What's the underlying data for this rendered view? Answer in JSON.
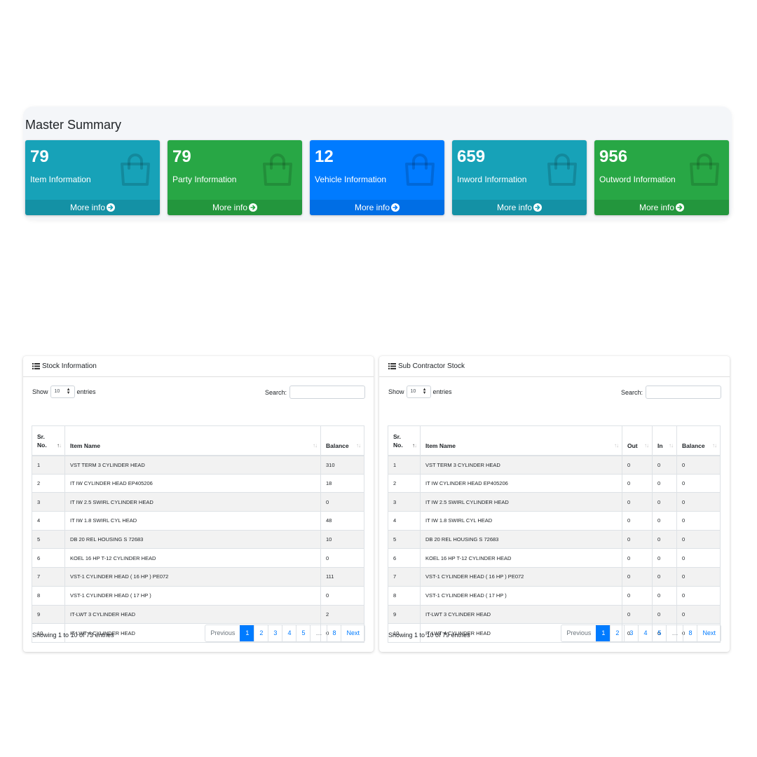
{
  "summary": {
    "title": "Master Summary",
    "more_info": "More info",
    "boxes": [
      {
        "number": "79",
        "label": "Item Information",
        "color": "#17a2b8"
      },
      {
        "number": "79",
        "label": "Party Information",
        "color": "#28a745"
      },
      {
        "number": "12",
        "label": "Vehicle Information",
        "color": "#007bff"
      },
      {
        "number": "659",
        "label": "Inword Information",
        "color": "#17a2b8"
      },
      {
        "number": "956",
        "label": "Outword Information",
        "color": "#28a745"
      }
    ]
  },
  "stock": {
    "title": "Stock Information",
    "show_label": "Show",
    "entries_value": "10",
    "entries_label": "entries",
    "search_label": "Search:",
    "columns": [
      "Sr. No.",
      "Item Name",
      "Balance"
    ],
    "rows": [
      [
        "1",
        "VST TERM 3 CYLINDER HEAD",
        "310"
      ],
      [
        "2",
        "IT IW CYLINDER HEAD EP405206",
        "18"
      ],
      [
        "3",
        "IT IW 2.5 SWIRL CYLINDER HEAD",
        "0"
      ],
      [
        "4",
        "IT IW 1.8 SWIRL CYL HEAD",
        "48"
      ],
      [
        "5",
        "DB 20 REL HOUSING S 72683",
        "10"
      ],
      [
        "6",
        "KOEL 16 HP T-12 CYLINDER HEAD",
        "0"
      ],
      [
        "7",
        "VST-1 CYLINDER HEAD ( 16 HP ) PE072",
        "111"
      ],
      [
        "8",
        "VST-1 CYLINDER HEAD ( 17 HP )",
        "0"
      ],
      [
        "9",
        "IT-LWT 3 CYLINDER HEAD",
        "2"
      ],
      [
        "10",
        "IT LWT 4 CYLINDER HEAD",
        "0"
      ]
    ],
    "info": "Showing 1 to 10 of 73 entries",
    "pagination": [
      "Previous",
      "1",
      "2",
      "3",
      "4",
      "5",
      "…",
      "8",
      "Next"
    ]
  },
  "subcontractor": {
    "title": "Sub Contractor Stock",
    "show_label": "Show",
    "entries_value": "10",
    "entries_label": "entries",
    "search_label": "Search:",
    "columns": [
      "Sr. No.",
      "Item Name",
      "Out",
      "In",
      "Balance"
    ],
    "rows": [
      [
        "1",
        "VST TERM 3 CYLINDER HEAD",
        "0",
        "0",
        "0"
      ],
      [
        "2",
        "IT IW CYLINDER HEAD EP405206",
        "0",
        "0",
        "0"
      ],
      [
        "3",
        "IT IW 2.5 SWIRL CYLINDER HEAD",
        "0",
        "0",
        "0"
      ],
      [
        "4",
        "IT IW 1.8 SWIRL CYL HEAD",
        "0",
        "0",
        "0"
      ],
      [
        "5",
        "DB 20 REL HOUSING S 72683",
        "0",
        "0",
        "0"
      ],
      [
        "6",
        "KOEL 16 HP T-12 CYLINDER HEAD",
        "0",
        "0",
        "0"
      ],
      [
        "7",
        "VST-1 CYLINDER HEAD ( 16 HP ) PE072",
        "0",
        "0",
        "0"
      ],
      [
        "8",
        "VST-1 CYLINDER HEAD ( 17 HP )",
        "0",
        "0",
        "0"
      ],
      [
        "9",
        "IT-LWT 3 CYLINDER HEAD",
        "0",
        "0",
        "0"
      ],
      [
        "10",
        "IT LWT 4 CYLINDER HEAD",
        "0",
        "0",
        "0"
      ]
    ],
    "info": "Showing 1 to 10 of 79 entries",
    "pagination": [
      "Previous",
      "1",
      "2",
      "3",
      "4",
      "5",
      "…",
      "8",
      "Next"
    ]
  },
  "icons": {
    "box_icon": "shopping-bag-icon",
    "footer_icon": "arrow-circle-right-icon",
    "card_icon": "list-icon"
  }
}
